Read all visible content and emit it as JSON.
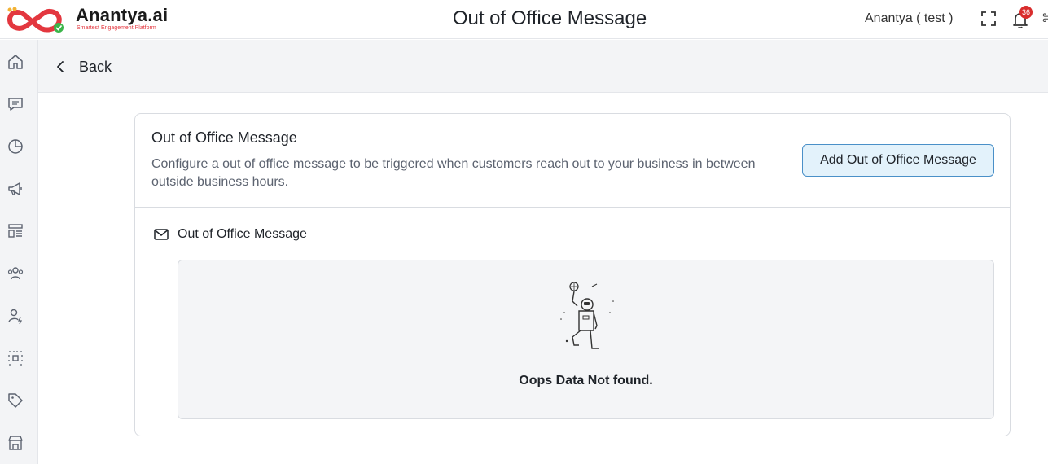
{
  "app": {
    "name": "Anantya.ai",
    "tagline": "Smartest Engagement Platform",
    "brand_color": "#e3373f",
    "accent_color": "#4a90c8"
  },
  "header": {
    "title": "Out of Office Message",
    "user": "Anantya ( test )",
    "notifications_count": "36",
    "icons": [
      "fullscreen-icon",
      "bell-icon"
    ]
  },
  "sidebar": {
    "items": [
      {
        "icon": "home-icon"
      },
      {
        "icon": "chat-icon"
      },
      {
        "icon": "pie-chart-icon"
      },
      {
        "icon": "megaphone-icon"
      },
      {
        "icon": "template-icon"
      },
      {
        "icon": "contacts-icon"
      },
      {
        "icon": "user-bolt-icon"
      },
      {
        "icon": "integration-icon"
      },
      {
        "icon": "tag-icon"
      },
      {
        "icon": "store-icon"
      }
    ]
  },
  "back": {
    "label": "Back"
  },
  "card": {
    "title": "Out of Office Message",
    "description": "Configure a out of office message to be triggered when customers reach out to your business in between outside business hours.",
    "add_button": "Add Out of Office Message",
    "section_label": "Out of Office Message",
    "empty_text": "Oops Data Not found."
  }
}
